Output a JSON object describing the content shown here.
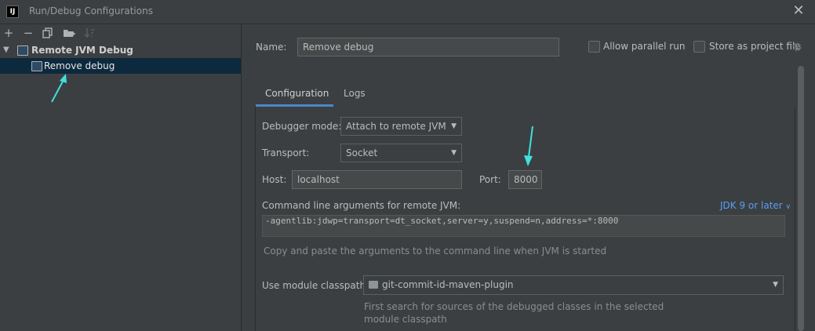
{
  "window": {
    "title": "Run/Debug Configurations",
    "app_icon": "IJ"
  },
  "toolbar": {
    "icons": [
      "add-icon",
      "remove-icon",
      "copy-icon",
      "folder-add-icon",
      "sort-icon"
    ],
    "add": "+",
    "remove": "−"
  },
  "tree": {
    "group_label": "Remote JVM Debug",
    "items": [
      {
        "label": "Remove debug",
        "selected": true
      }
    ]
  },
  "form": {
    "name_label": "Name:",
    "name_value": "Remove debug",
    "allow_parallel_label": "Allow parallel run",
    "allow_parallel_checked": false,
    "store_as_file_label": "Store as project file",
    "store_as_file_checked": false
  },
  "tabs": [
    {
      "label": "Configuration",
      "active": true
    },
    {
      "label": "Logs",
      "active": false
    }
  ],
  "configuration": {
    "debugger_mode_label": "Debugger mode:",
    "debugger_mode_value": "Attach to remote JVM",
    "transport_label": "Transport:",
    "transport_value": "Socket",
    "host_label": "Host:",
    "host_value": "localhost",
    "port_label": "Port:",
    "port_value": "8000",
    "cmd_label": "Command line arguments for remote JVM:",
    "jdk_link": "JDK 9 or later",
    "cmd_value": "-agentlib:jdwp=transport=dt_socket,server=y,suspend=n,address=*:8000",
    "cmd_hint": "Copy and paste the arguments to the command line when JVM is started",
    "module_label": "Use module classpath:",
    "module_value": "git-commit-id-maven-plugin",
    "module_hint_line1": "First search for sources of the debugged classes in the selected",
    "module_hint_line2": "module classpath"
  },
  "colors": {
    "background": "#3c3f41",
    "selection": "#0d293e",
    "accent": "#4a88c7",
    "link": "#589df6",
    "annotation_arrow": "#3fe0e0"
  }
}
